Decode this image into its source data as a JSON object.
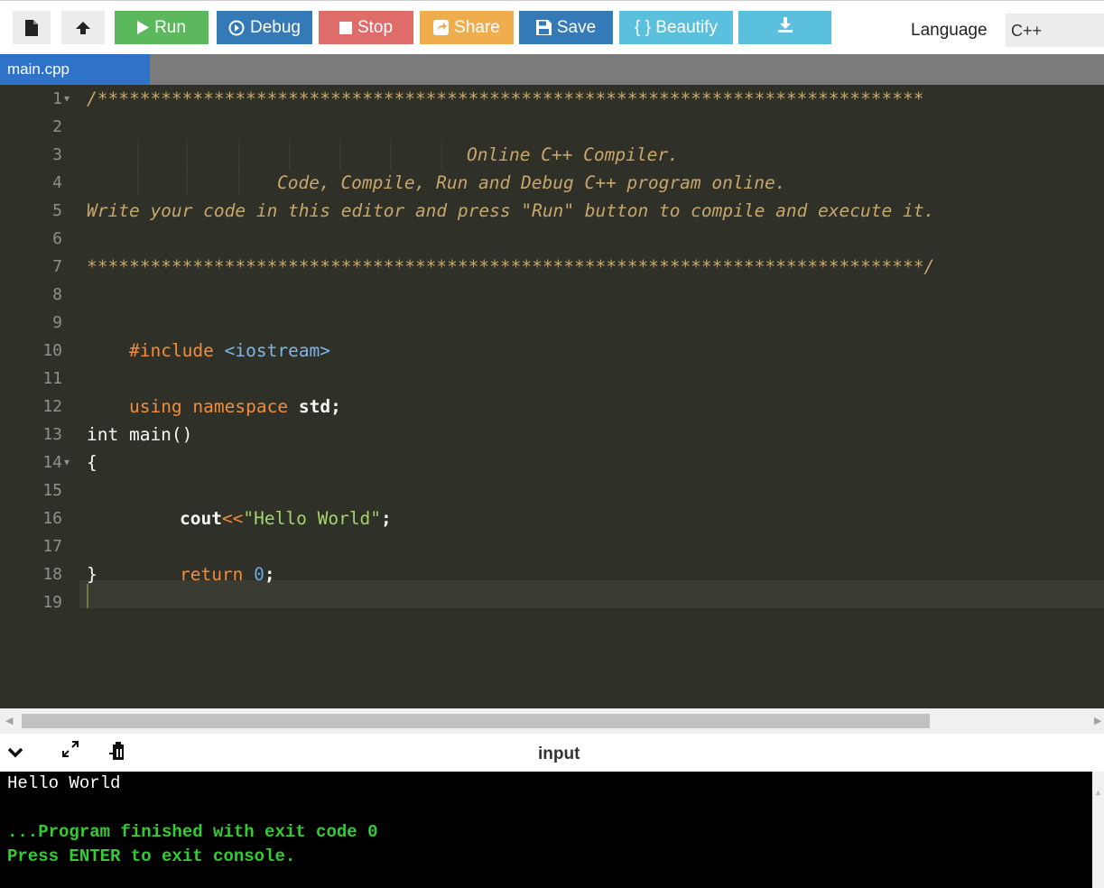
{
  "toolbar": {
    "new_file_icon": "file-icon",
    "upload_icon": "upload-icon",
    "run": {
      "label": "Run",
      "icon": "play-icon",
      "color": "#5cb85c"
    },
    "debug": {
      "label": "Debug",
      "icon": "debug-icon",
      "color": "#337ab7"
    },
    "stop": {
      "label": "Stop",
      "icon": "stop-icon",
      "color": "#d9534f"
    },
    "share": {
      "label": "Share",
      "icon": "share-icon",
      "color": "#f0ad4e"
    },
    "save": {
      "label": "Save",
      "icon": "save-icon",
      "color": "#337ab7"
    },
    "beautify": {
      "label": "{ } Beautify",
      "color": "#5bc0de"
    },
    "download": {
      "icon": "download-icon",
      "color": "#5bc0de"
    },
    "language_label": "Language",
    "language_value": "C++"
  },
  "tabs": [
    {
      "label": "main.cpp",
      "active": true
    }
  ],
  "editor": {
    "line_numbers": [
      "1",
      "2",
      "3",
      "4",
      "5",
      "6",
      "7",
      "8",
      "9",
      "10",
      "11",
      "12",
      "13",
      "14",
      "15",
      "16",
      "17",
      "18",
      "19"
    ],
    "lines": {
      "l1": "/******************************************************************************",
      "l3": "Online C++ Compiler.",
      "l4": "Code, Compile, Run and Debug C++ program online.",
      "l5": "Write your code in this editor and press \"Run\" button to compile and execute it.",
      "l7": "*******************************************************************************/",
      "l9_directive": "#include",
      "l9_lib": "<iostream>",
      "l11_using": "using",
      "l11_namespace": "namespace",
      "l11_std": "std;",
      "l13": "int main()",
      "l14": "{",
      "l15_cout": "cout",
      "l15_op": "<<",
      "l15_str": "\"Hello World\"",
      "l15_end": ";",
      "l17_kw": "return",
      "l17_num": "0",
      "l17_end": ";",
      "l18": "}"
    }
  },
  "console_header": {
    "collapse_icon": "chevron-down-icon",
    "expand_icon": "expand-icon",
    "clear_icon": "clear-console-icon",
    "input_label": "input"
  },
  "console": {
    "line1": "Hello World",
    "line2": "...Program finished with exit code 0",
    "line3": "Press ENTER to exit console."
  }
}
